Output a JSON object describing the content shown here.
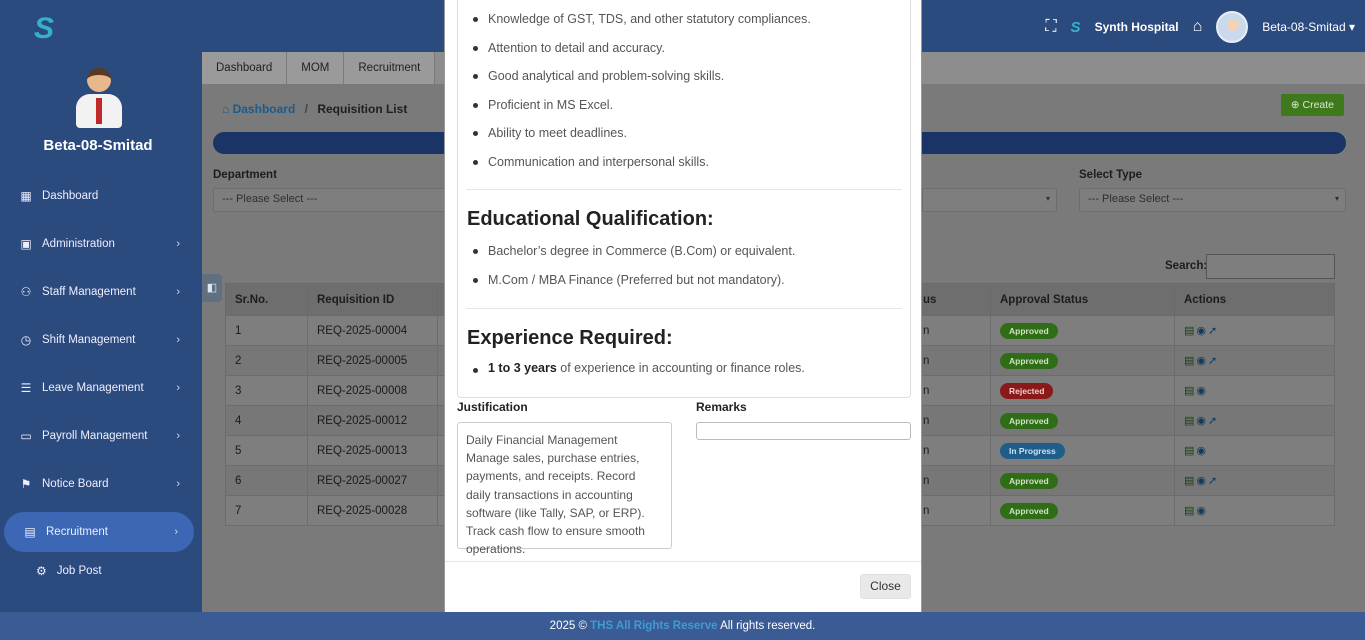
{
  "brand": {
    "logo": "S",
    "footer_year": "2025 ©",
    "footer_brand": "THS All Rights Reserve",
    "footer_rest": "All rights reserved."
  },
  "header": {
    "hospital": "Synth Hospital",
    "user": "Beta-08-Smitad",
    "user_caret": "▾"
  },
  "sidebar": {
    "user": "Beta-08-Smitad",
    "items": [
      {
        "label": "Dashboard",
        "icon": "dashboard-icon",
        "glyph": "▦"
      },
      {
        "label": "Administration",
        "icon": "admin-icon",
        "glyph": "▣"
      },
      {
        "label": "Staff Management",
        "icon": "users-icon",
        "glyph": "⚇"
      },
      {
        "label": "Shift Management",
        "icon": "clock-icon",
        "glyph": "◷"
      },
      {
        "label": "Leave Management",
        "icon": "list-icon",
        "glyph": "☰"
      },
      {
        "label": "Payroll Management",
        "icon": "money-icon",
        "glyph": "▭"
      },
      {
        "label": "Notice Board",
        "icon": "flag-icon",
        "glyph": "⚑"
      },
      {
        "label": "Recruitment",
        "icon": "recruitment-icon",
        "glyph": "▤"
      }
    ],
    "sub_items": [
      {
        "label": "Job Post",
        "glyph": "⚙"
      }
    ]
  },
  "tabs": [
    "Dashboard",
    "MOM",
    "Recruitment"
  ],
  "breadcrumb": {
    "home": "Dashboard",
    "sep": "/",
    "current": "Requisition List"
  },
  "create_label": "Create",
  "filters": {
    "department_label": "Department",
    "department_value": "--- Please Select ---",
    "type_label": "Select Type",
    "type_value": "--- Please Select ---"
  },
  "search_label": "Search:",
  "table": {
    "headers": [
      "Sr.No.",
      "Requisition ID",
      "us",
      "Approval Status",
      "Actions"
    ],
    "rows": [
      {
        "sr": "1",
        "id": "REQ-2025-00004",
        "st": "n",
        "approval": "Approved",
        "kind": "approved"
      },
      {
        "sr": "2",
        "id": "REQ-2025-00005",
        "st": "n",
        "approval": "Approved",
        "kind": "approved"
      },
      {
        "sr": "3",
        "id": "REQ-2025-00008",
        "st": "n",
        "approval": "Rejected",
        "kind": "rejected"
      },
      {
        "sr": "4",
        "id": "REQ-2025-00012",
        "st": "n",
        "approval": "Approved",
        "kind": "approved"
      },
      {
        "sr": "5",
        "id": "REQ-2025-00013",
        "st": "n",
        "approval": "In Progress",
        "kind": "progress"
      },
      {
        "sr": "6",
        "id": "REQ-2025-00027",
        "st": "n",
        "approval": "Approved",
        "kind": "approved"
      },
      {
        "sr": "7",
        "id": "REQ-2025-00028",
        "st": "n",
        "approval": "Approved",
        "kind": "approved"
      }
    ]
  },
  "modal": {
    "skills": [
      "Knowledge of GST, TDS, and other statutory compliances.",
      "Attention to detail and accuracy.",
      "Good analytical and problem-solving skills.",
      "Proficient in MS Excel.",
      "Ability to meet deadlines.",
      "Communication and interpersonal skills."
    ],
    "edu_heading": "Educational Qualification:",
    "edu": [
      "Bachelor’s degree in Commerce (B.Com) or equivalent.",
      "M.Com / MBA Finance (Preferred but not mandatory)."
    ],
    "exp_heading": "Experience Required:",
    "exp_bold": "1 to 3 years",
    "exp_rest": "of experience in accounting or finance roles.",
    "justification_label": "Justification",
    "justification": "Daily Financial Management Manage sales, purchase entries, payments, and receipts. Record daily transactions in accounting software (like Tally, SAP, or ERP). Track cash flow to ensure smooth operations.",
    "remarks_label": "Remarks",
    "remarks_value": "",
    "close_label": "Close"
  }
}
